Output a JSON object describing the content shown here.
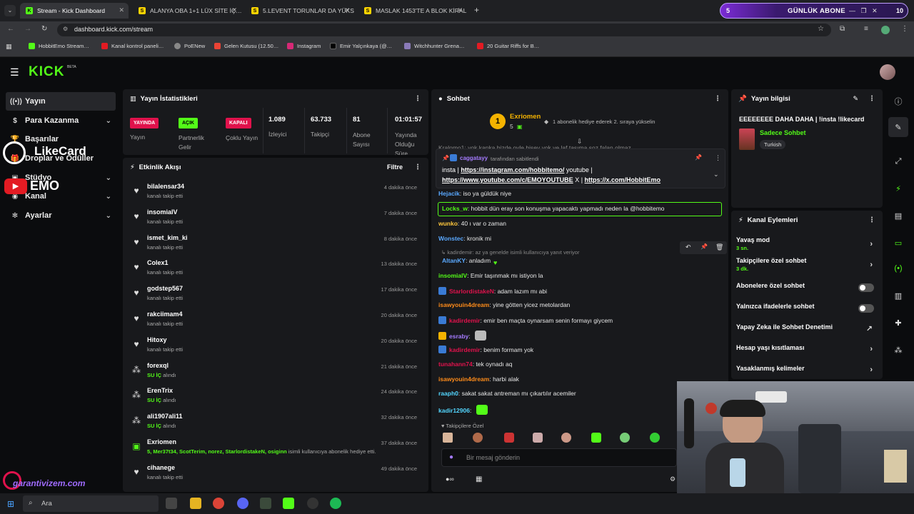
{
  "browser": {
    "tabs": [
      "Stream - Kick Dashboard",
      "ALANYA OBA 1+1 LÜX SİTE İÇ…",
      "5.LEVENT TORUNLAR DA YÜKS…",
      "MASLAK 1453'TE A BLOK KİRAL…"
    ],
    "url": "dashboard.kick.com/stream",
    "bookmarks": [
      "HobbitEmo Stream…",
      "Kanal kontrol paneli…",
      "PoENew",
      "Gelen Kutusu (12.50…",
      "Instagram",
      "Emir Yalçınkaya (@…",
      "Witchhunter Grena…",
      "20 Guitar Riffs for B…"
    ],
    "goal": {
      "count": "5",
      "label": "GÜNLÜK ABONE",
      "target": "10"
    }
  },
  "app": {
    "logo": "KICK",
    "beta": "BETA"
  },
  "leftnav": {
    "items": [
      {
        "label": "Yayın",
        "icon": "broadcast-icon"
      },
      {
        "label": "Para Kazanma",
        "icon": "money-icon"
      },
      {
        "label": "Başarılar",
        "icon": "trophy-icon"
      },
      {
        "label": "Droplar ve Ödüller",
        "icon": "gift-icon"
      },
      {
        "label": "Stüdyo",
        "icon": "studio-icon"
      },
      {
        "label": "Kanal",
        "icon": "channel-icon"
      },
      {
        "label": "Ayarlar",
        "icon": "gear-icon"
      }
    ]
  },
  "overlay": {
    "likecard": "LikeCard",
    "emo": "EMO",
    "garanti": "garantivizem.com"
  },
  "stats": {
    "title": "Yayın İstatistikleri",
    "badges": [
      {
        "text": "YAYINDA",
        "label": "Yayın",
        "color": "#e0124c"
      },
      {
        "text": "AÇIK",
        "label": "Partnerlik Gelir",
        "color": "#53fc18"
      },
      {
        "text": "KAPALI",
        "label": "Çoklu Yayın",
        "color": "#e0124c"
      }
    ],
    "values": [
      {
        "value": "1.089",
        "label": "İzleyici"
      },
      {
        "value": "63.733",
        "label": "Takipçi"
      },
      {
        "value": "81",
        "label": "Abone Sayısı"
      },
      {
        "value": "01:01:57",
        "label": "Yayında Olduğu Süre"
      }
    ]
  },
  "activity": {
    "title": "Etkinlik Akışı",
    "filter": "Filtre",
    "items": [
      {
        "name": "bilalensar34",
        "sub": "kanalı takip etti",
        "time": "4 dakika önce",
        "icon": "heart-icon"
      },
      {
        "name": "insomialV",
        "sub": "kanalı takip etti",
        "time": "7 dakika önce",
        "icon": "heart-icon"
      },
      {
        "name": "ismet_kim_ki",
        "sub": "kanalı takip etti",
        "time": "8 dakika önce",
        "icon": "heart-icon"
      },
      {
        "name": "Colex1",
        "sub": "kanalı takip etti",
        "time": "13 dakika önce",
        "icon": "heart-icon"
      },
      {
        "name": "godstep567",
        "sub": "kanalı takip etti",
        "time": "17 dakika önce",
        "icon": "heart-icon"
      },
      {
        "name": "rakciimam4",
        "sub": "kanalı takip etti",
        "time": "20 dakika önce",
        "icon": "heart-icon"
      },
      {
        "name": "Hitoxy",
        "sub": "kanalı takip etti",
        "time": "20 dakika önce",
        "icon": "heart-icon"
      },
      {
        "name": "forexql",
        "reward": "SU İÇ",
        "sub": "alındı",
        "time": "21 dakika önce",
        "icon": "reward-icon"
      },
      {
        "name": "ErenTrix",
        "reward": "SU İÇ",
        "sub": "alındı",
        "time": "24 dakika önce",
        "icon": "reward-icon"
      },
      {
        "name": "ali1907ali11",
        "reward": "SU İÇ",
        "sub": "alındı",
        "time": "32 dakika önce",
        "icon": "reward-icon"
      },
      {
        "name": "Exriomen",
        "reward": "5, Mer37t34, ScotTerim, norez, StarlordistakeN, osiginn",
        "sub": "isimli kullanıcıya abonelik hediye etti.",
        "time": "37 dakika önce",
        "icon": "gift-sub-icon"
      },
      {
        "name": "cihanege",
        "sub": "kanalı takip etti",
        "time": "49 dakika önce",
        "icon": "heart-icon"
      }
    ]
  },
  "chat": {
    "title": "Sohbet",
    "gifter": {
      "rank": "1",
      "name": "Exriomen",
      "count": "5",
      "text": "1 abonelik hediye ederek 2. sıraya yükselin"
    },
    "cut": "Kralomo1: yok kanka bizde oyle bisey yok ve laf tasıma soz falan olmaz",
    "pinned": {
      "by": "caggatayy",
      "suffix": "tarafından sabitlendi",
      "line1a": "insta | ",
      "link1": "https://instagram.com/hobbitemo/",
      "line1b": " youtube |",
      "link2": "https://www.youtube.com/c/EMOYOUTUBE",
      "line2b": " X | ",
      "link3": "https://x.com/HobbitEmo"
    },
    "reply": "kadirdemir: az ya genelde isimli kullanıcıya yanıt veriyor",
    "messages": [
      {
        "user": "Hejacik",
        "color": "#5aa9ff",
        "text": "iso ya güldük niye"
      },
      {
        "user": "Locks_w",
        "color": "#53fc18",
        "text": "hobbit dün eray son konuşma yapacaktı yapmadı neden la @hobbitemo"
      },
      {
        "user": "wunko",
        "color": "#ffc83d",
        "text": "40 ı var o zaman"
      },
      {
        "user": "Wonstec",
        "color": "#5aa9ff",
        "text": "kronik mi"
      },
      {
        "user": "AltanKY",
        "color": "#5aa9ff",
        "text": "anladım"
      },
      {
        "user": "insomialV",
        "color": "#53fc18",
        "text": "Emir taşınmak mı istiyon la"
      },
      {
        "user": "StarlordistakeN",
        "color": "#e0124c",
        "text": "adam lazım mı abi"
      },
      {
        "user": "isawyouin4dream",
        "color": "#ff8c1a",
        "text": "yine götten yicez metolardan"
      },
      {
        "user": "kadirdemir",
        "color": "#e0124c",
        "text": "emir ben maçta oynarsam senin formayı giycem"
      },
      {
        "user": "esraby",
        "color": "#a57bff",
        "text": ""
      },
      {
        "user": "kadirdemir",
        "color": "#e0124c",
        "text": "benim formam yok"
      },
      {
        "user": "tunahann74",
        "color": "#e0124c",
        "text": "tek oynadı aq"
      },
      {
        "user": "isawyouin4dream",
        "color": "#ff8c1a",
        "text": "harbi alak"
      },
      {
        "user": "raaph0",
        "color": "#53d6ff",
        "text": "sakat sakat antreman mı çıkartılır acemiler"
      },
      {
        "user": "kadir12906",
        "color": "#53d6ff",
        "text": ""
      }
    ],
    "followers_only": "Takipçilere Özel",
    "placeholder": "Bir mesaj gönderin"
  },
  "streaminfo": {
    "title": "Yayın bilgisi",
    "stream_title": "EEEEEEEE DAHA DAHA | !insta !likecard",
    "category": "Sadece Sohbet",
    "tag": "Turkish"
  },
  "channelactions": {
    "title": "Kanal Eylemleri",
    "items": [
      {
        "label": "Yavaş mod",
        "value": "3 sn.",
        "control": "chevron"
      },
      {
        "label": "Takipçilere özel sohbet",
        "value": "3 dk.",
        "control": "chevron"
      },
      {
        "label": "Abonelere özel sohbet",
        "value": "",
        "control": "toggle"
      },
      {
        "label": "Yalnızca ifadelerle sohbet",
        "value": "",
        "control": "toggle"
      },
      {
        "label": "Yapay Zeka ile Sohbet Denetimi",
        "value": "",
        "control": "external"
      },
      {
        "label": "Hesap yaşı kısıtlaması",
        "value": "",
        "control": "chevron"
      },
      {
        "label": "Yasaklanmış kelimeler",
        "value": "",
        "control": "chevron"
      }
    ]
  },
  "taskbar": {
    "search": "Ara"
  },
  "colors": {
    "accent": "#53fc18",
    "live": "#e0124c",
    "panel": "#18191c",
    "bg": "#0b0c0e"
  }
}
